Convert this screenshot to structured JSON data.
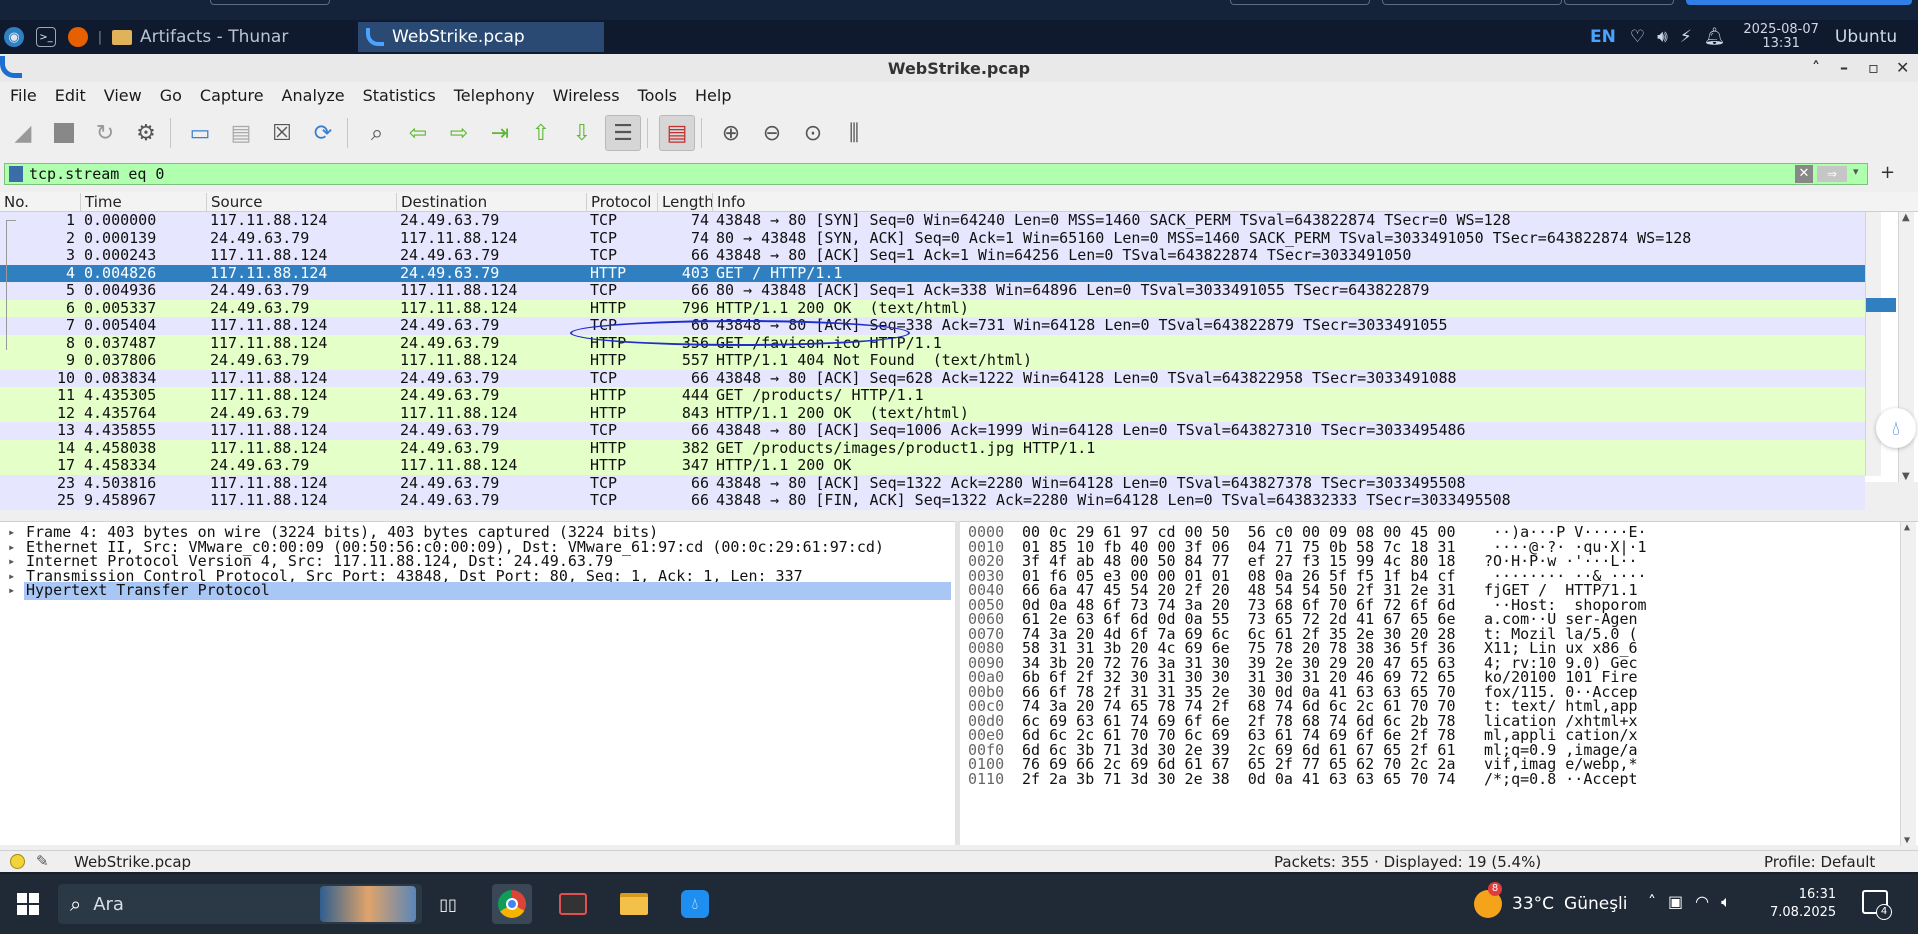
{
  "xfce_panel": {
    "tasks": [
      {
        "label": "Artifacts - Thunar",
        "active": false
      },
      {
        "label": "WebStrike.pcap",
        "active": true
      }
    ],
    "lang": "EN",
    "date": "2025-08-07",
    "time": "13:31",
    "user": "Ubuntu"
  },
  "window": {
    "title": "WebStrike.pcap",
    "menu": [
      "File",
      "Edit",
      "View",
      "Go",
      "Capture",
      "Analyze",
      "Statistics",
      "Telephony",
      "Wireless",
      "Tools",
      "Help"
    ]
  },
  "filter": {
    "value": "tcp.stream eq 0",
    "add_label": "+"
  },
  "packet_list": {
    "columns": [
      "No.",
      "Time",
      "Source",
      "Destination",
      "Protocol",
      "Length",
      "Info"
    ],
    "rows": [
      {
        "no": "1",
        "time": "0.000000",
        "src": "117.11.88.124",
        "dst": "24.49.63.79",
        "proto": "TCP",
        "len": "74",
        "info": "43848 → 80 [SYN] Seq=0 Win=64240 Len=0 MSS=1460 SACK_PERM TSval=643822874 TSecr=0 WS=128",
        "cls": "tcp"
      },
      {
        "no": "2",
        "time": "0.000139",
        "src": "24.49.63.79",
        "dst": "117.11.88.124",
        "proto": "TCP",
        "len": "74",
        "info": "80 → 43848 [SYN, ACK] Seq=0 Ack=1 Win=65160 Len=0 MSS=1460 SACK_PERM TSval=3033491050 TSecr=643822874 WS=128",
        "cls": "tcp"
      },
      {
        "no": "3",
        "time": "0.000243",
        "src": "117.11.88.124",
        "dst": "24.49.63.79",
        "proto": "TCP",
        "len": "66",
        "info": "43848 → 80 [ACK] Seq=1 Ack=1 Win=64256 Len=0 TSval=643822874 TSecr=3033491050",
        "cls": "tcp"
      },
      {
        "no": "4",
        "time": "0.004826",
        "src": "117.11.88.124",
        "dst": "24.49.63.79",
        "proto": "HTTP",
        "len": "403",
        "info": "GET / HTTP/1.1",
        "cls": "sel"
      },
      {
        "no": "5",
        "time": "0.004936",
        "src": "24.49.63.79",
        "dst": "117.11.88.124",
        "proto": "TCP",
        "len": "66",
        "info": "80 → 43848 [ACK] Seq=1 Ack=338 Win=64896 Len=0 TSval=3033491055 TSecr=643822879",
        "cls": "tcp"
      },
      {
        "no": "6",
        "time": "0.005337",
        "src": "24.49.63.79",
        "dst": "117.11.88.124",
        "proto": "HTTP",
        "len": "796",
        "info": "HTTP/1.1 200 OK  (text/html)",
        "cls": "http"
      },
      {
        "no": "7",
        "time": "0.005404",
        "src": "117.11.88.124",
        "dst": "24.49.63.79",
        "proto": "TCP",
        "len": "66",
        "info": "43848 → 80 [ACK] Seq=338 Ack=731 Win=64128 Len=0 TSval=643822879 TSecr=3033491055",
        "cls": "tcp"
      },
      {
        "no": "8",
        "time": "0.037487",
        "src": "117.11.88.124",
        "dst": "24.49.63.79",
        "proto": "HTTP",
        "len": "356",
        "info": "GET /favicon.ico HTTP/1.1",
        "cls": "http"
      },
      {
        "no": "9",
        "time": "0.037806",
        "src": "24.49.63.79",
        "dst": "117.11.88.124",
        "proto": "HTTP",
        "len": "557",
        "info": "HTTP/1.1 404 Not Found  (text/html)",
        "cls": "http"
      },
      {
        "no": "10",
        "time": "0.083834",
        "src": "117.11.88.124",
        "dst": "24.49.63.79",
        "proto": "TCP",
        "len": "66",
        "info": "43848 → 80 [ACK] Seq=628 Ack=1222 Win=64128 Len=0 TSval=643822958 TSecr=3033491088",
        "cls": "tcp"
      },
      {
        "no": "11",
        "time": "4.435305",
        "src": "117.11.88.124",
        "dst": "24.49.63.79",
        "proto": "HTTP",
        "len": "444",
        "info": "GET /products/ HTTP/1.1",
        "cls": "http"
      },
      {
        "no": "12",
        "time": "4.435764",
        "src": "24.49.63.79",
        "dst": "117.11.88.124",
        "proto": "HTTP",
        "len": "843",
        "info": "HTTP/1.1 200 OK  (text/html)",
        "cls": "http"
      },
      {
        "no": "13",
        "time": "4.435855",
        "src": "117.11.88.124",
        "dst": "24.49.63.79",
        "proto": "TCP",
        "len": "66",
        "info": "43848 → 80 [ACK] Seq=1006 Ack=1999 Win=64128 Len=0 TSval=643827310 TSecr=3033495486",
        "cls": "tcp"
      },
      {
        "no": "14",
        "time": "4.458038",
        "src": "117.11.88.124",
        "dst": "24.49.63.79",
        "proto": "HTTP",
        "len": "382",
        "info": "GET /products/images/product1.jpg HTTP/1.1",
        "cls": "http"
      },
      {
        "no": "17",
        "time": "4.458334",
        "src": "24.49.63.79",
        "dst": "117.11.88.124",
        "proto": "HTTP",
        "len": "347",
        "info": "HTTP/1.1 200 OK",
        "cls": "http"
      },
      {
        "no": "23",
        "time": "4.503816",
        "src": "117.11.88.124",
        "dst": "24.49.63.79",
        "proto": "TCP",
        "len": "66",
        "info": "43848 → 80 [ACK] Seq=1322 Ack=2280 Win=64128 Len=0 TSval=643827378 TSecr=3033495508",
        "cls": "tcp"
      },
      {
        "no": "25",
        "time": "9.458967",
        "src": "117.11.88.124",
        "dst": "24.49.63.79",
        "proto": "TCP",
        "len": "66",
        "info": "43848 → 80 [FIN, ACK] Seq=1322 Ack=2280 Win=64128 Len=0 TSval=643832333 TSecr=3033495508",
        "cls": "tcp"
      }
    ]
  },
  "details": [
    {
      "text": "Frame 4: 403 bytes on wire (3224 bits), 403 bytes captured (3224 bits)",
      "sel": false
    },
    {
      "text": "Ethernet II, Src: VMware_c0:00:09 (00:50:56:c0:00:09), Dst: VMware_61:97:cd (00:0c:29:61:97:cd)",
      "sel": false
    },
    {
      "text": "Internet Protocol Version 4, Src: 117.11.88.124, Dst: 24.49.63.79",
      "sel": false
    },
    {
      "text": "Transmission Control Protocol, Src Port: 43848, Dst Port: 80, Seq: 1, Ack: 1, Len: 337",
      "sel": false
    },
    {
      "text": "Hypertext Transfer Protocol",
      "sel": true
    }
  ],
  "bytes": [
    {
      "off": "0000",
      "hex": "00 0c 29 61 97 cd 00 50  56 c0 00 09 08 00 45 00",
      "asc": " ··)a···P V·····E·"
    },
    {
      "off": "0010",
      "hex": "01 85 10 fb 40 00 3f 06  04 71 75 0b 58 7c 18 31",
      "asc": " ····@·?· ·qu·X|·1"
    },
    {
      "off": "0020",
      "hex": "3f 4f ab 48 00 50 84 77  ef 27 f3 15 99 4c 80 18",
      "asc": "?O·H·P·w ·'···L··"
    },
    {
      "off": "0030",
      "hex": "01 f6 05 e3 00 00 01 01  08 0a 26 5f f5 1f b4 cf",
      "asc": " ········ ··&_····"
    },
    {
      "off": "0040",
      "hex": "66 6a 47 45 54 20 2f 20  48 54 54 50 2f 31 2e 31",
      "asc": "fjGET /  HTTP/1.1"
    },
    {
      "off": "0050",
      "hex": "0d 0a 48 6f 73 74 3a 20  73 68 6f 70 6f 72 6f 6d",
      "asc": " ··Host:  shoporom"
    },
    {
      "off": "0060",
      "hex": "61 2e 63 6f 6d 0d 0a 55  73 65 72 2d 41 67 65 6e",
      "asc": "a.com··U ser-Agen"
    },
    {
      "off": "0070",
      "hex": "74 3a 20 4d 6f 7a 69 6c  6c 61 2f 35 2e 30 20 28",
      "asc": "t: Mozil la/5.0 ("
    },
    {
      "off": "0080",
      "hex": "58 31 31 3b 20 4c 69 6e  75 78 20 78 38 36 5f 36",
      "asc": "X11; Lin ux x86_6"
    },
    {
      "off": "0090",
      "hex": "34 3b 20 72 76 3a 31 30  39 2e 30 29 20 47 65 63",
      "asc": "4; rv:10 9.0) Gec"
    },
    {
      "off": "00a0",
      "hex": "6b 6f 2f 32 30 31 30 30  31 30 31 20 46 69 72 65",
      "asc": "ko/20100 101 Fire"
    },
    {
      "off": "00b0",
      "hex": "66 6f 78 2f 31 31 35 2e  30 0d 0a 41 63 63 65 70",
      "asc": "fox/115. 0··Accep"
    },
    {
      "off": "00c0",
      "hex": "74 3a 20 74 65 78 74 2f  68 74 6d 6c 2c 61 70 70",
      "asc": "t: text/ html,app"
    },
    {
      "off": "00d0",
      "hex": "6c 69 63 61 74 69 6f 6e  2f 78 68 74 6d 6c 2b 78",
      "asc": "lication /xhtml+x"
    },
    {
      "off": "00e0",
      "hex": "6d 6c 2c 61 70 70 6c 69  63 61 74 69 6f 6e 2f 78",
      "asc": "ml,appli cation/x"
    },
    {
      "off": "00f0",
      "hex": "6d 6c 3b 71 3d 30 2e 39  2c 69 6d 61 67 65 2f 61",
      "asc": "ml;q=0.9 ,image/a"
    },
    {
      "off": "0100",
      "hex": "76 69 66 2c 69 6d 61 67  65 2f 77 65 62 70 2c 2a",
      "asc": "vif,imag e/webp,*"
    },
    {
      "off": "0110",
      "hex": "2f 2a 3b 71 3d 30 2e 38  0d 0a 41 63 63 65 70 74",
      "asc": "/*;q=0.8 ··Accept"
    }
  ],
  "status": {
    "file": "WebStrike.pcap",
    "counts": "Packets: 355 · Displayed: 19 (5.4%)",
    "profile": "Profile: Default"
  },
  "taskbar": {
    "search": "Ara",
    "weather_temp": "33°C",
    "weather_text": "Güneşli",
    "weather_badge": "8",
    "time": "16:31",
    "date": "7.08.2025",
    "notif_count": "4"
  },
  "colors": {
    "tcp_row": "#e7e6ff",
    "http_row": "#e4ffc7",
    "selected_row": "#2f7fc1",
    "filter_ok": "#afffaf"
  }
}
